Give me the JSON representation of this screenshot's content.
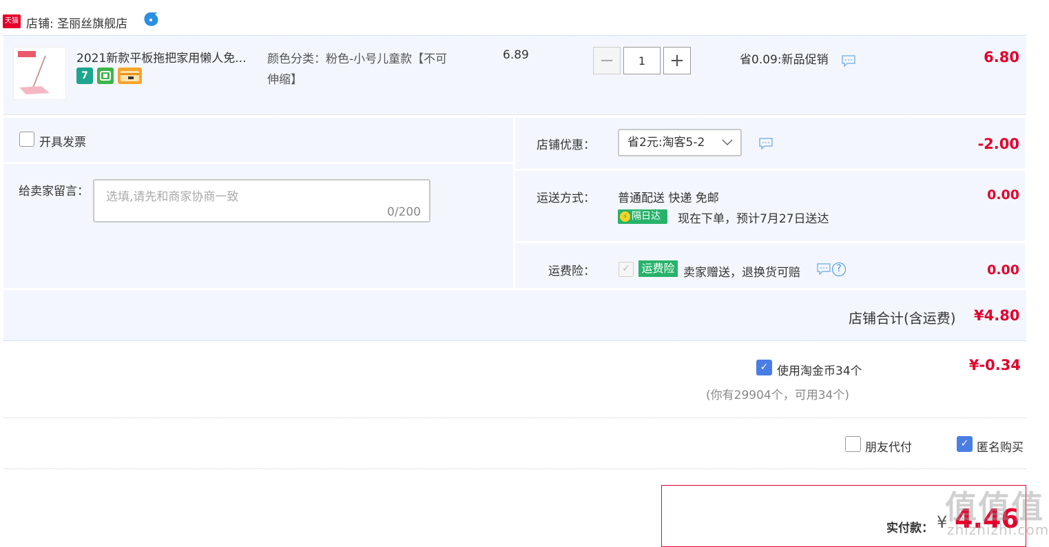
{
  "shop": {
    "platform_badge": "天猫",
    "name": "店铺: 圣丽丝旗舰店"
  },
  "item": {
    "title": "2021新款平板拖把家用懒人免...",
    "badges": [
      "7"
    ],
    "sku": "颜色分类：粉色-小号儿童款【不可伸缩】",
    "unit_price": "6.89",
    "qty_minus": "−",
    "qty_value": "1",
    "qty_plus": "+",
    "promo": "省0.09:新品促销",
    "total": "6.80"
  },
  "invoice": {
    "label": "开具发票"
  },
  "message": {
    "label": "给卖家留言：",
    "placeholder": "选填,请先和商家协商一致",
    "count": "0/200"
  },
  "shop_discount": {
    "label": "店铺优惠：",
    "selected": "省2元:淘客5-2",
    "amount": "-2.00"
  },
  "delivery": {
    "label": "运送方式：",
    "method": "普通配送 快递 免邮",
    "next_day_badge": "隔日达",
    "eta": "现在下单，预计7月27日送达",
    "amount": "0.00"
  },
  "shipping_insurance": {
    "label": "运费险：",
    "tag": "运费险",
    "desc": "卖家赠送，退换货可赔",
    "help": "?",
    "amount": "0.00"
  },
  "subtotal": {
    "label": "店铺合计(含运费)",
    "value": "¥4.80"
  },
  "coins": {
    "label": "使用淘金币34个",
    "note": "(你有29904个，可用34个)",
    "amount": "¥-0.34"
  },
  "options": {
    "friend_pay": "朋友代付",
    "anonymous": "匿名购买"
  },
  "payment": {
    "label": "实付款：",
    "currency": "¥",
    "value": "4.46"
  },
  "watermark": {
    "main": "值值值",
    "sub": "zhizhizhi.com"
  },
  "colors": {
    "accent_red": "#e4002b",
    "panel_bg": "#f3f7fd",
    "green_tag": "#27b36a",
    "check_blue": "#4a7ee6"
  }
}
